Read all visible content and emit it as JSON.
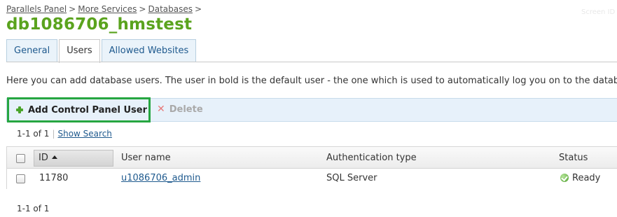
{
  "breadcrumb": {
    "items": [
      "Parallels Panel",
      "More Services",
      "Databases"
    ],
    "separator": ">"
  },
  "screen_id": "Screen ID",
  "page_title": "db1086706_hmstest",
  "tabs": [
    {
      "label": "General",
      "active": false
    },
    {
      "label": "Users",
      "active": true
    },
    {
      "label": "Allowed Websites",
      "active": false
    }
  ],
  "intro_text": "Here you can add database users. The user in bold is the default user - the one which is used to automatically log you on to the database m",
  "toolbar": {
    "add_label": "Add Control Panel User",
    "add_icon": "plus-icon",
    "delete_label": "Delete",
    "delete_icon": "x-icon"
  },
  "pager_top": {
    "range": "1-1 of 1",
    "show_search": "Show Search"
  },
  "table": {
    "columns": [
      "ID",
      "User name",
      "Authentication type",
      "Status"
    ],
    "sort_column": "ID",
    "sort_direction": "ascending",
    "rows": [
      {
        "id": "11780",
        "user_name": "u1086706_admin",
        "auth_type": "SQL Server",
        "status": "Ready",
        "status_icon": "ready-icon"
      }
    ]
  },
  "pager_bottom": {
    "range": "1-1 of 1"
  },
  "colors": {
    "title_green": "#5aa31e",
    "link_blue": "#1f5a8e",
    "highlight_green": "#26a641",
    "toolbar_bg": "#e7f1fa"
  }
}
